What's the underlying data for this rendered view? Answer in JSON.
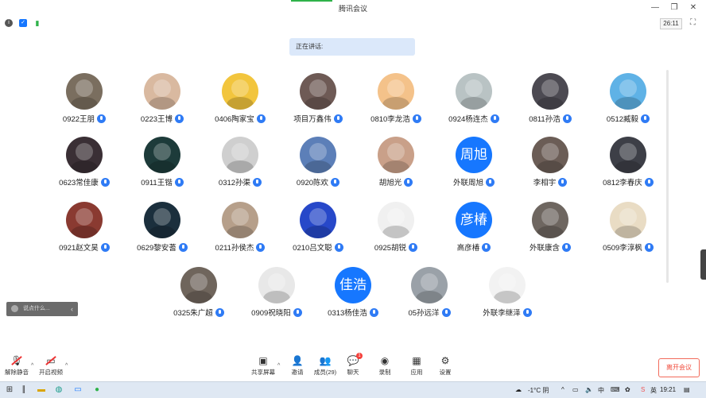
{
  "window": {
    "title": "腾讯会议",
    "minimize": "—",
    "restore": "❐",
    "close": "✕"
  },
  "info": {
    "timer": "26:11"
  },
  "speaking": {
    "label": "正在讲话:"
  },
  "participants": [
    {
      "name": "0922王朋",
      "avatar_color": "#7a6e5f",
      "initials": ""
    },
    {
      "name": "0223王博",
      "avatar_color": "#d9b9a0",
      "initials": ""
    },
    {
      "name": "0406陶家宝",
      "avatar_color": "#f2c53d",
      "initials": ""
    },
    {
      "name": "项目万鑫伟",
      "avatar_color": "#6e5a55",
      "initials": ""
    },
    {
      "name": "0810李龙浩",
      "avatar_color": "#f4c28a",
      "initials": ""
    },
    {
      "name": "0924杨连杰",
      "avatar_color": "#b9c3c4",
      "initials": ""
    },
    {
      "name": "0811孙浩",
      "avatar_color": "#4c4a52",
      "initials": ""
    },
    {
      "name": "0512臧毅",
      "avatar_color": "#5fb2e6",
      "initials": ""
    },
    {
      "name": "0623常佳康",
      "avatar_color": "#3a2f35",
      "initials": ""
    },
    {
      "name": "0911王锴",
      "avatar_color": "#1d3b3a",
      "initials": ""
    },
    {
      "name": "0312孙渠",
      "avatar_color": "#cfcfcf",
      "initials": ""
    },
    {
      "name": "0920陈欢",
      "avatar_color": "#5c7fb8",
      "initials": ""
    },
    {
      "name": "胡旭光",
      "avatar_color": "#c9a089",
      "initials": ""
    },
    {
      "name": "外联周旭",
      "avatar_color": "#1677ff",
      "initials": "周旭"
    },
    {
      "name": "李相宇",
      "avatar_color": "#6b5d56",
      "initials": ""
    },
    {
      "name": "0812李春庆",
      "avatar_color": "#3d3f47",
      "initials": ""
    },
    {
      "name": "0921赵文昊",
      "avatar_color": "#8a3a31",
      "initials": ""
    },
    {
      "name": "0629黎安蓍",
      "avatar_color": "#1b2f3d",
      "initials": ""
    },
    {
      "name": "0211孙侯杰",
      "avatar_color": "#b69f8a",
      "initials": ""
    },
    {
      "name": "0210吕文聪",
      "avatar_color": "#2748c9",
      "initials": ""
    },
    {
      "name": "0925胡锐",
      "avatar_color": "#f0f0f0",
      "initials": ""
    },
    {
      "name": "高彦椿",
      "avatar_color": "#1677ff",
      "initials": "彦椿"
    },
    {
      "name": "外联康含",
      "avatar_color": "#6e6660",
      "initials": ""
    },
    {
      "name": "0509李淳枫",
      "avatar_color": "#e9dcc4",
      "initials": ""
    },
    {
      "name": "0325朱广超",
      "avatar_color": "#6f655c",
      "initials": ""
    },
    {
      "name": "0909祝晓阳",
      "avatar_color": "#e8e8e8",
      "initials": ""
    },
    {
      "name": "0313杨佳浩",
      "avatar_color": "#1677ff",
      "initials": "佳浩"
    },
    {
      "name": "05孙远洋",
      "avatar_color": "#9aa1a8",
      "initials": ""
    },
    {
      "name": "外联李继泽",
      "avatar_color": "#f2f2f2",
      "initials": ""
    }
  ],
  "chat": {
    "placeholder": "说点什么...",
    "toggle": "‹"
  },
  "toolbar": {
    "unmute": "解除静音",
    "start_video": "开启视频",
    "share_screen": "共享屏幕",
    "invite": "邀请",
    "members": "成员(29)",
    "chat": "聊天",
    "chat_badge": "1",
    "record": "录制",
    "apps": "应用",
    "settings": "设置",
    "leave": "离开会议"
  },
  "taskbar": {
    "weather": "-1°C 阴",
    "ime": "中",
    "ime2": "英",
    "time": "19:21"
  },
  "colors": {
    "accent": "#1677ff",
    "mic": "#2f7bf5",
    "leave": "#f04a3a"
  }
}
